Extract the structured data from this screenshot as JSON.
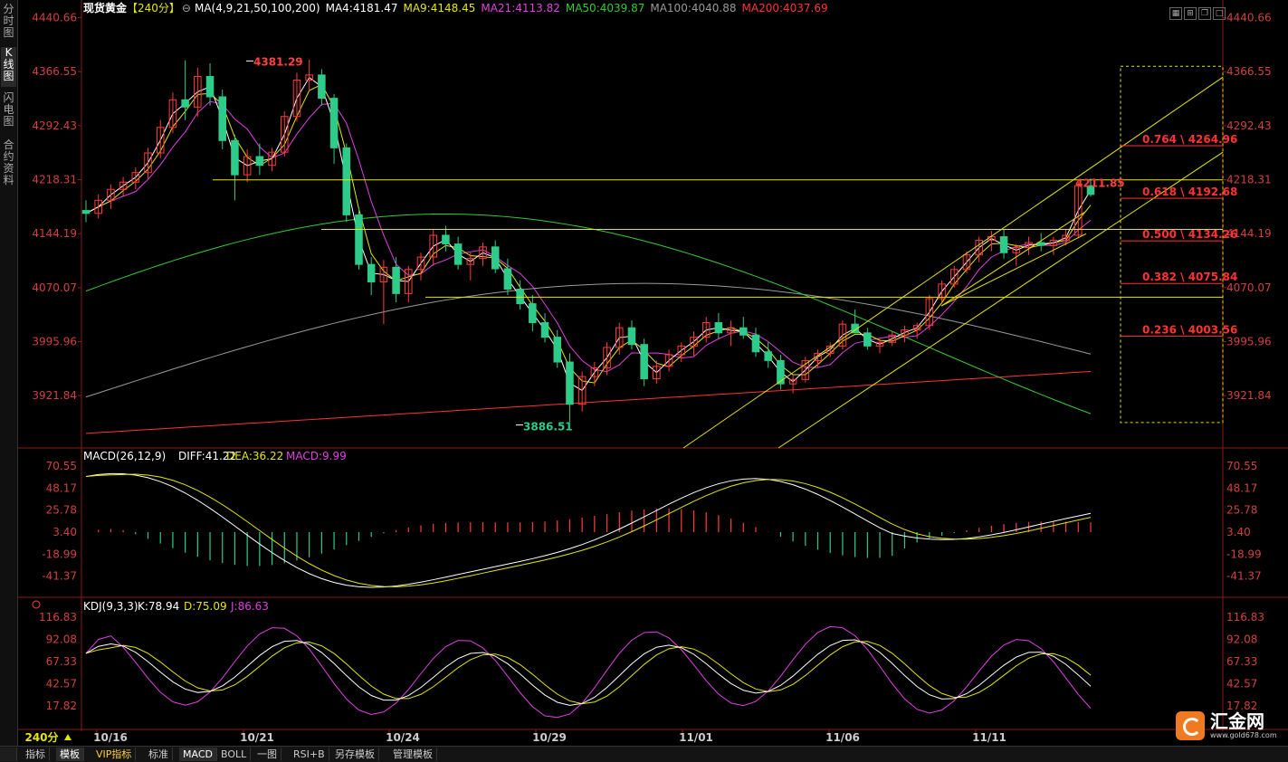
{
  "left_tabs": [
    {
      "label": "分时图"
    },
    {
      "label": "K线图"
    },
    {
      "label": "闪电图"
    },
    {
      "label": "合约资料"
    }
  ],
  "header": {
    "title": "现货黄金",
    "period": "【240分】",
    "ma_params": "MA(4,9,21,50,100,200)",
    "ma": [
      {
        "label": "MA4:4181.47",
        "color": "#ffffff"
      },
      {
        "label": "MA9:4148.45",
        "color": "#e6e600"
      },
      {
        "label": "MA21:4113.82",
        "color": "#e040e0"
      },
      {
        "label": "MA50:4039.87",
        "color": "#33cc33"
      },
      {
        "label": "MA100:4040.88",
        "color": "#9a9a9a"
      },
      {
        "label": "MA200:4037.69",
        "color": "#ff3333"
      }
    ]
  },
  "price_axis": {
    "ticks": [
      "4440.66",
      "4366.55",
      "4292.43",
      "4218.31",
      "4144.19",
      "4070.07",
      "3995.96",
      "3921.84"
    ]
  },
  "annotations": {
    "high": "4381.29",
    "low": "3886.51",
    "last": "4211.85",
    "fib": [
      {
        "label": "0.764 \\ 4264.96"
      },
      {
        "label": "0.618 \\ 4192.68"
      },
      {
        "label": "0.500 \\ 4134.26"
      },
      {
        "label": "0.382 \\ 4075.84"
      },
      {
        "label": "0.236 \\ 4003.56"
      }
    ]
  },
  "macd": {
    "params": "MACD(26,12,9)",
    "diff": "DIFF:41.22",
    "dea": "DEA:36.22",
    "macd": "MACD:9.99",
    "ticks": [
      "70.55",
      "48.17",
      "25.78",
      "3.40",
      "-18.99",
      "-41.37"
    ]
  },
  "kdj": {
    "params": "KDJ(9,3,3)",
    "k": "K:78.94",
    "d": "D:75.09",
    "j": "J:86.63",
    "ticks": [
      "116.83",
      "92.08",
      "67.33",
      "42.57",
      "17.82"
    ]
  },
  "date_axis": {
    "period_label": "240分",
    "dates": [
      "10/16",
      "10/21",
      "10/24",
      "10/29",
      "11/01",
      "11/06",
      "11/11"
    ]
  },
  "bottom_tabs": [
    {
      "label": "指标"
    },
    {
      "label": "模板"
    },
    {
      "label": "VIP指标"
    },
    {
      "label": "标准"
    },
    {
      "label": "MACD"
    },
    {
      "label": "BOLL"
    },
    {
      "label": "一图"
    },
    {
      "label": "RSI+B"
    },
    {
      "label": "另存模板"
    },
    {
      "label": "管理模板"
    }
  ],
  "logo": {
    "text": "汇金网",
    "url": "www.gold678.com"
  },
  "chart_data": {
    "type": "candlestick",
    "title": "现货黄金【240分】",
    "ylim": [
      3860,
      4450
    ],
    "bars": [
      [
        4176,
        4190,
        4160,
        4172
      ],
      [
        4172,
        4198,
        4165,
        4190
      ],
      [
        4190,
        4212,
        4178,
        4205
      ],
      [
        4205,
        4222,
        4195,
        4215
      ],
      [
        4215,
        4235,
        4205,
        4228
      ],
      [
        4228,
        4262,
        4220,
        4255
      ],
      [
        4255,
        4300,
        4248,
        4290
      ],
      [
        4290,
        4338,
        4282,
        4328
      ],
      [
        4328,
        4382,
        4300,
        4318
      ],
      [
        4318,
        4372,
        4305,
        4360
      ],
      [
        4360,
        4378,
        4320,
        4332
      ],
      [
        4332,
        4342,
        4260,
        4272
      ],
      [
        4272,
        4280,
        4190,
        4225
      ],
      [
        4225,
        4260,
        4215,
        4250
      ],
      [
        4250,
        4268,
        4225,
        4238
      ],
      [
        4238,
        4262,
        4230,
        4256
      ],
      [
        4256,
        4312,
        4250,
        4305
      ],
      [
        4305,
        4365,
        4298,
        4355
      ],
      [
        4355,
        4383,
        4340,
        4362
      ],
      [
        4362,
        4370,
        4320,
        4330
      ],
      [
        4330,
        4336,
        4240,
        4262
      ],
      [
        4262,
        4268,
        4160,
        4170
      ],
      [
        4170,
        4180,
        4095,
        4102
      ],
      [
        4102,
        4112,
        4060,
        4078
      ],
      [
        4078,
        4108,
        4020,
        4098
      ],
      [
        4098,
        4112,
        4050,
        4062
      ],
      [
        4062,
        4100,
        4050,
        4095
      ],
      [
        4095,
        4118,
        4080,
        4112
      ],
      [
        4112,
        4150,
        4100,
        4142
      ],
      [
        4142,
        4155,
        4120,
        4130
      ],
      [
        4130,
        4140,
        4095,
        4102
      ],
      [
        4102,
        4118,
        4080,
        4110
      ],
      [
        4110,
        4132,
        4100,
        4126
      ],
      [
        4126,
        4135,
        4090,
        4096
      ],
      [
        4096,
        4110,
        4060,
        4068
      ],
      [
        4068,
        4080,
        4040,
        4048
      ],
      [
        4048,
        4060,
        4010,
        4022
      ],
      [
        4022,
        4035,
        3995,
        4002
      ],
      [
        4002,
        4012,
        3960,
        3968
      ],
      [
        3968,
        3980,
        3886,
        3910
      ],
      [
        3910,
        3955,
        3900,
        3948
      ],
      [
        3948,
        3968,
        3935,
        3960
      ],
      [
        3960,
        3995,
        3950,
        3988
      ],
      [
        3988,
        4022,
        3978,
        4015
      ],
      [
        4015,
        4025,
        3985,
        3992
      ],
      [
        3992,
        4000,
        3935,
        3945
      ],
      [
        3945,
        3970,
        3938,
        3962
      ],
      [
        3962,
        3985,
        3955,
        3978
      ],
      [
        3978,
        3995,
        3968,
        3990
      ],
      [
        3990,
        4010,
        3975,
        4002
      ],
      [
        4002,
        4030,
        3995,
        4022
      ],
      [
        4022,
        4035,
        4000,
        4008
      ],
      [
        4008,
        4025,
        3990,
        4015
      ],
      [
        4015,
        4030,
        4000,
        4005
      ],
      [
        4005,
        4015,
        3975,
        3982
      ],
      [
        3982,
        3995,
        3960,
        3970
      ],
      [
        3970,
        3978,
        3930,
        3938
      ],
      [
        3938,
        3950,
        3925,
        3944
      ],
      [
        3944,
        3975,
        3940,
        3970
      ],
      [
        3970,
        3985,
        3960,
        3980
      ],
      [
        3980,
        3995,
        3975,
        3990
      ],
      [
        3990,
        4025,
        3985,
        4020
      ],
      [
        4020,
        4040,
        4010,
        4008
      ],
      [
        4008,
        4015,
        3985,
        3990
      ],
      [
        3990,
        4000,
        3980,
        3995
      ],
      [
        3995,
        4010,
        3990,
        4005
      ],
      [
        4005,
        4018,
        3995,
        4012
      ],
      [
        4012,
        4022,
        4000,
        4018
      ],
      [
        4018,
        4060,
        4012,
        4055
      ],
      [
        4055,
        4080,
        4050,
        4075
      ],
      [
        4075,
        4100,
        4070,
        4095
      ],
      [
        4095,
        4120,
        4090,
        4115
      ],
      [
        4115,
        4140,
        4105,
        4135
      ],
      [
        4135,
        4148,
        4120,
        4140
      ],
      [
        4140,
        4150,
        4110,
        4118
      ],
      [
        4118,
        4130,
        4100,
        4125
      ],
      [
        4125,
        4140,
        4115,
        4132
      ],
      [
        4132,
        4145,
        4120,
        4128
      ],
      [
        4128,
        4140,
        4115,
        4135
      ],
      [
        4135,
        4150,
        4128,
        4142
      ],
      [
        4142,
        4215,
        4138,
        4210
      ],
      [
        4210,
        4220,
        4195,
        4198
      ]
    ]
  }
}
